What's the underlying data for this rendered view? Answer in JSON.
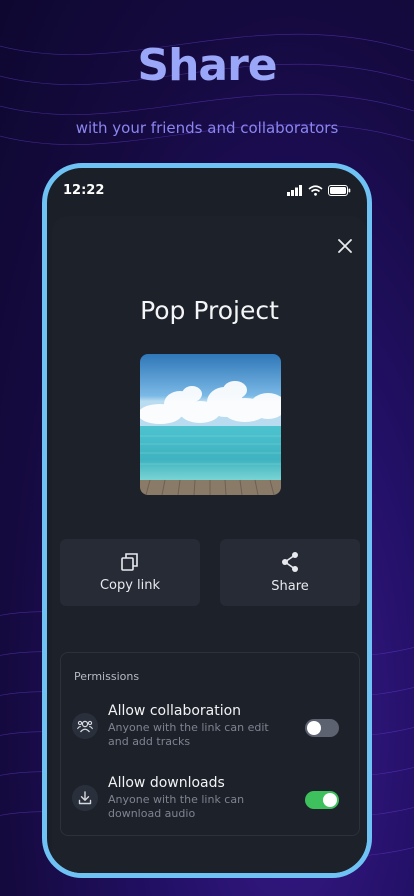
{
  "hero": {
    "title": "Share",
    "subtitle": "with your friends and collaborators"
  },
  "status_bar": {
    "time": "12:22",
    "icons": [
      "signal-icon",
      "wifi-icon",
      "battery-icon"
    ]
  },
  "sheet": {
    "close_icon": "close-icon",
    "project_title": "Pop Project",
    "actions": [
      {
        "label": "Copy link",
        "icon": "copy-icon"
      },
      {
        "label": "Share",
        "icon": "share-icon"
      }
    ],
    "permissions": {
      "header": "Permissions",
      "items": [
        {
          "title": "Allow collaboration",
          "description": "Anyone with the link can edit and add tracks",
          "icon": "collaborators-icon",
          "enabled": false
        },
        {
          "title": "Allow downloads",
          "description": "Anyone with the link can download audio",
          "icon": "download-icon",
          "enabled": true
        }
      ]
    }
  },
  "colors": {
    "accent_border": "#6fc2f4",
    "toggle_on": "#3ec15d",
    "toggle_off": "#5d6270",
    "hero_title": "#9aa6f7"
  }
}
